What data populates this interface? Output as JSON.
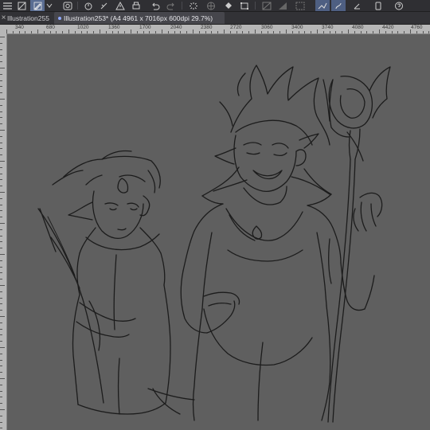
{
  "toolbar": {
    "icons": [
      "hamburger-menu-icon",
      "layer-view-icon",
      "pen-settings-icon",
      "chevron-down-icon",
      "circle-eye-icon",
      "timer-icon",
      "ruler-toggle-icon",
      "warning-icon",
      "print-icon",
      "undo-icon",
      "redo-icon",
      "loading-icon",
      "globe-icon",
      "bucket-icon",
      "transform-icon",
      "snap-icon",
      "gradient-icon",
      "selection-icon",
      "stroke-icon",
      "pen-icon",
      "smartphone-icon",
      "help-icon"
    ]
  },
  "tabs": [
    {
      "close": "×",
      "label": "Illustration255",
      "active": false
    },
    {
      "close": "×",
      "label": "Illustration253* (A4 4961 x 7016px 600dpi 29.7%)",
      "active": true
    }
  ],
  "ruler": {
    "labels": [
      "340",
      "680",
      "1020",
      "1360",
      "1700",
      "2040",
      "2380",
      "2720",
      "3060",
      "3400",
      "3740",
      "4080",
      "4420",
      "4760"
    ]
  },
  "canvas": {
    "background": "#5f5f5f",
    "stroke_color": "#1c1c1c"
  }
}
